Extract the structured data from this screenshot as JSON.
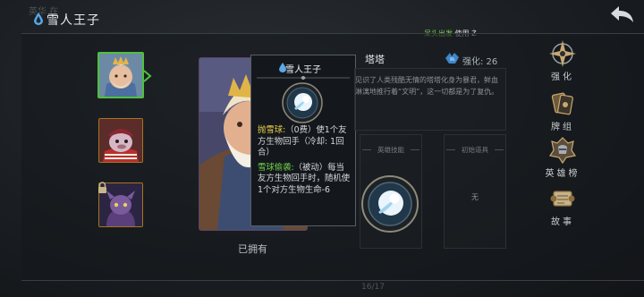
{
  "header": {
    "faded_text": "英华   在",
    "title": "雪人王子",
    "news": {
      "highlight": "呆头出发",
      "rest": " 使用 ",
      "tail": "Ż"
    }
  },
  "hero": {
    "name": "塔塔",
    "strength_label": "强化: 26",
    "lore": "见识了人类残酷无情的塔塔化身为暴君，鲜血淋漓地推行着“文明”，这一切都是为了复仇。",
    "owned_label": "已拥有"
  },
  "tooltip": {
    "title": "雪人王子",
    "skill1_name": "抛雪球:",
    "skill1_text": "（0费）使1个友方生物回手（冷却: 1回合）",
    "skill2_name": "雪球偷袭:",
    "skill2_text": "（被动）每当友方生物回手时，随机使1个对方生物生命-6"
  },
  "panels": {
    "skill_header": "英雄技能",
    "item_header": "初始道具",
    "item_none": "无"
  },
  "menu": {
    "strengthen": "强化",
    "deck": "牌组",
    "heroes": "英雄榜",
    "story": "故事"
  },
  "page_number": "16/17",
  "colors": {
    "selected_border": "#4fc23a",
    "slot_border": "#a8741f",
    "highlight_green": "#6fd04a",
    "highlight_yellow": "#ecd04a"
  }
}
